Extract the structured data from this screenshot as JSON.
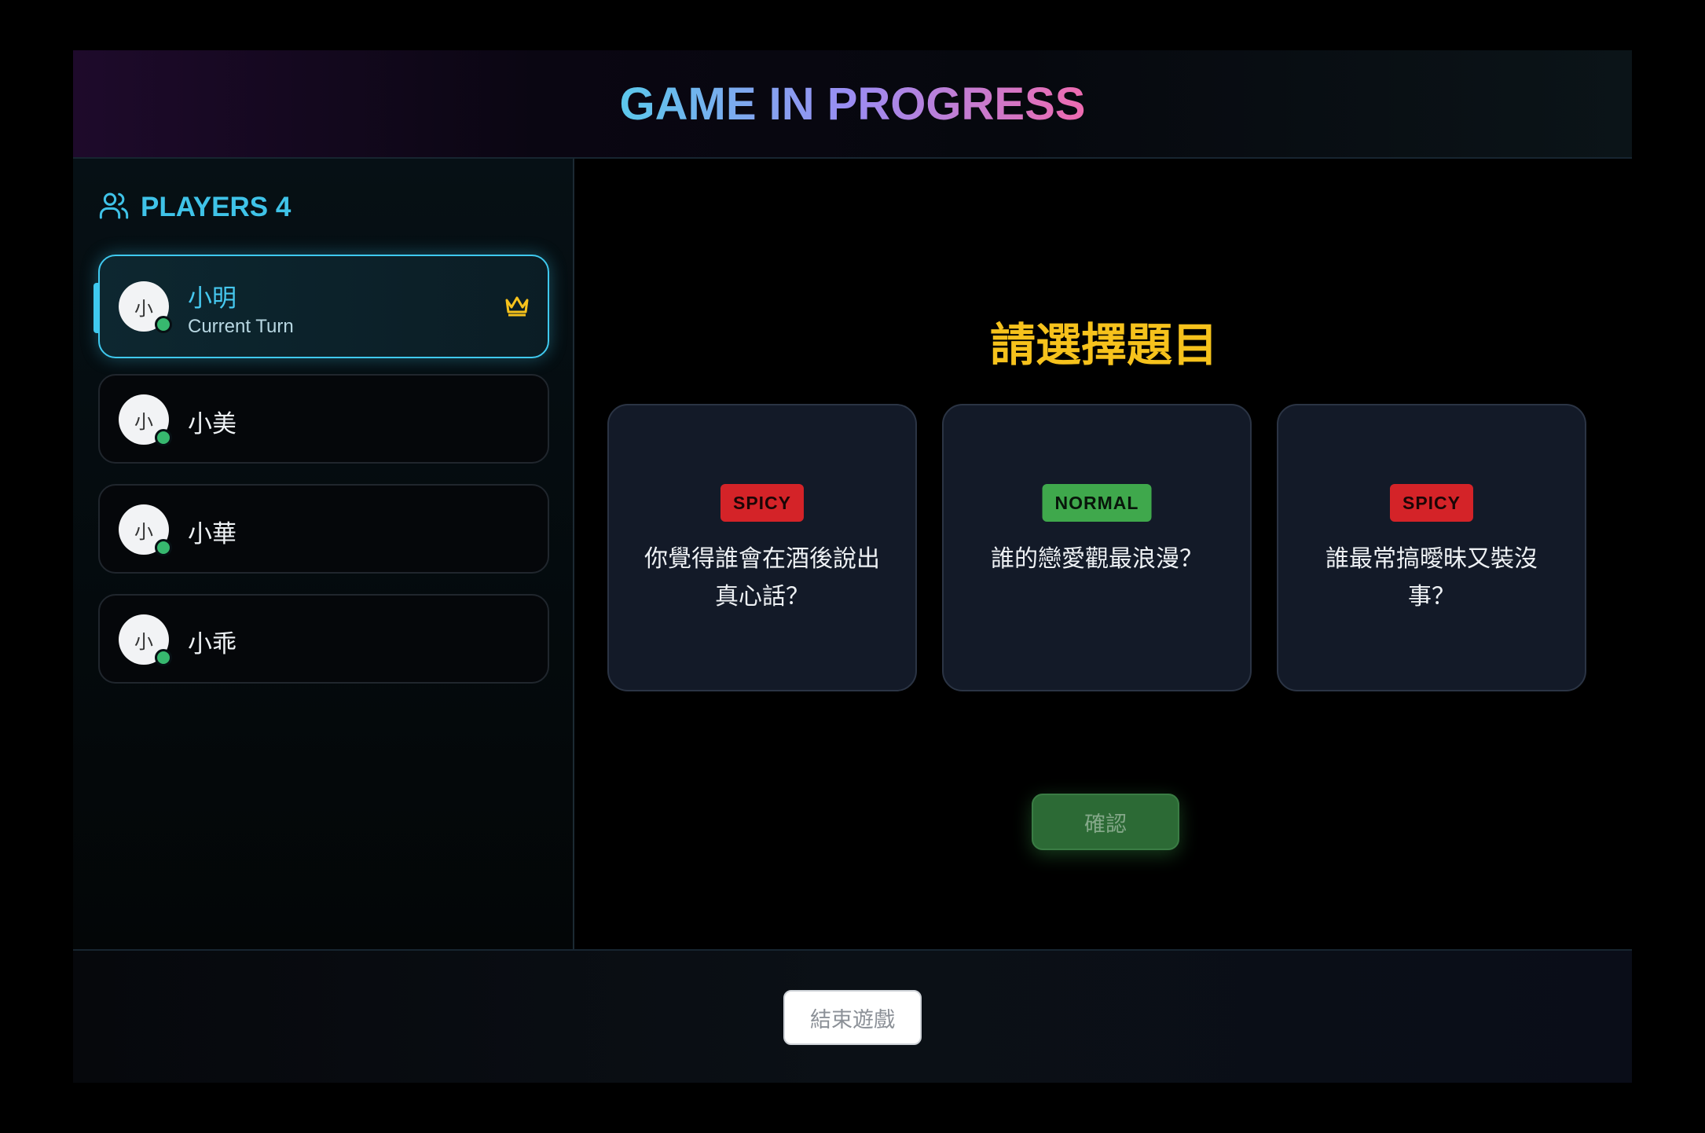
{
  "header": {
    "title": "GAME IN PROGRESS"
  },
  "sidebar": {
    "players_label": "PLAYERS 4",
    "players": [
      {
        "name": "小明",
        "avatar": "小",
        "status": "Current Turn",
        "online": true,
        "active": true
      },
      {
        "name": "小美",
        "avatar": "小",
        "online": true
      },
      {
        "name": "小華",
        "avatar": "小",
        "online": true
      },
      {
        "name": "小乖",
        "avatar": "小",
        "online": true
      }
    ]
  },
  "main": {
    "prompt": "請選擇題目",
    "cards": [
      {
        "tag": "SPICY",
        "question": "你覺得誰會在酒後說出真心話？"
      },
      {
        "tag": "NORMAL",
        "question": "誰的戀愛觀最浪漫？"
      },
      {
        "tag": "SPICY",
        "question": "誰最常搞曖昧又裝沒事？"
      }
    ],
    "confirm_label": "確認"
  },
  "footer": {
    "end_label": "結束遊戲"
  },
  "colors": {
    "accent": "#3fc9ef",
    "prompt": "#f6c21c",
    "spicy": "#d42328",
    "normal": "#3fa84c",
    "online": "#37b86f"
  },
  "icons": {
    "players": "users-icon",
    "host": "crown-icon"
  }
}
